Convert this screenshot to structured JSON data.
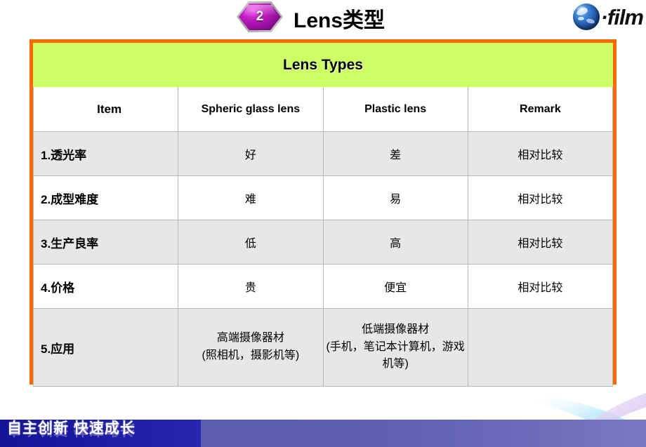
{
  "header": {
    "badge_number": "2",
    "title": "Lens类型",
    "logo_text": "·film",
    "logo_icon": "globe-icon"
  },
  "table": {
    "banner": "Lens Types",
    "columns": [
      "Item",
      "Spheric glass lens",
      "Plastic lens",
      "Remark"
    ],
    "rows": [
      {
        "item": "1.透光率",
        "glass": "好",
        "plastic": "差",
        "remark": "相对比较"
      },
      {
        "item": "2.成型难度",
        "glass": "难",
        "plastic": "易",
        "remark": "相对比较"
      },
      {
        "item": "3.生产良率",
        "glass": "低",
        "plastic": "高",
        "remark": "相对比较"
      },
      {
        "item": "4.价格",
        "glass": "贵",
        "plastic": "便宜",
        "remark": "相对比较"
      },
      {
        "item": "5.应用",
        "glass_line1": "高端摄像器材",
        "glass_line2": "(照相机，摄影机等)",
        "plastic_line1": "低端摄像器材",
        "plastic_line2": "(手机，笔记本计算机，游戏机等)",
        "remark": ""
      }
    ]
  },
  "footer": {
    "slogan": "自主创新  快速成长"
  },
  "colors": {
    "border_orange": "#FF6A00",
    "banner_green": "#CCFF66",
    "row_gray": "#E7E7E7",
    "footer_blue": "#1b1ba2",
    "footer_purple": "#5e5eb0",
    "badge_magenta": "#c41bc4"
  }
}
